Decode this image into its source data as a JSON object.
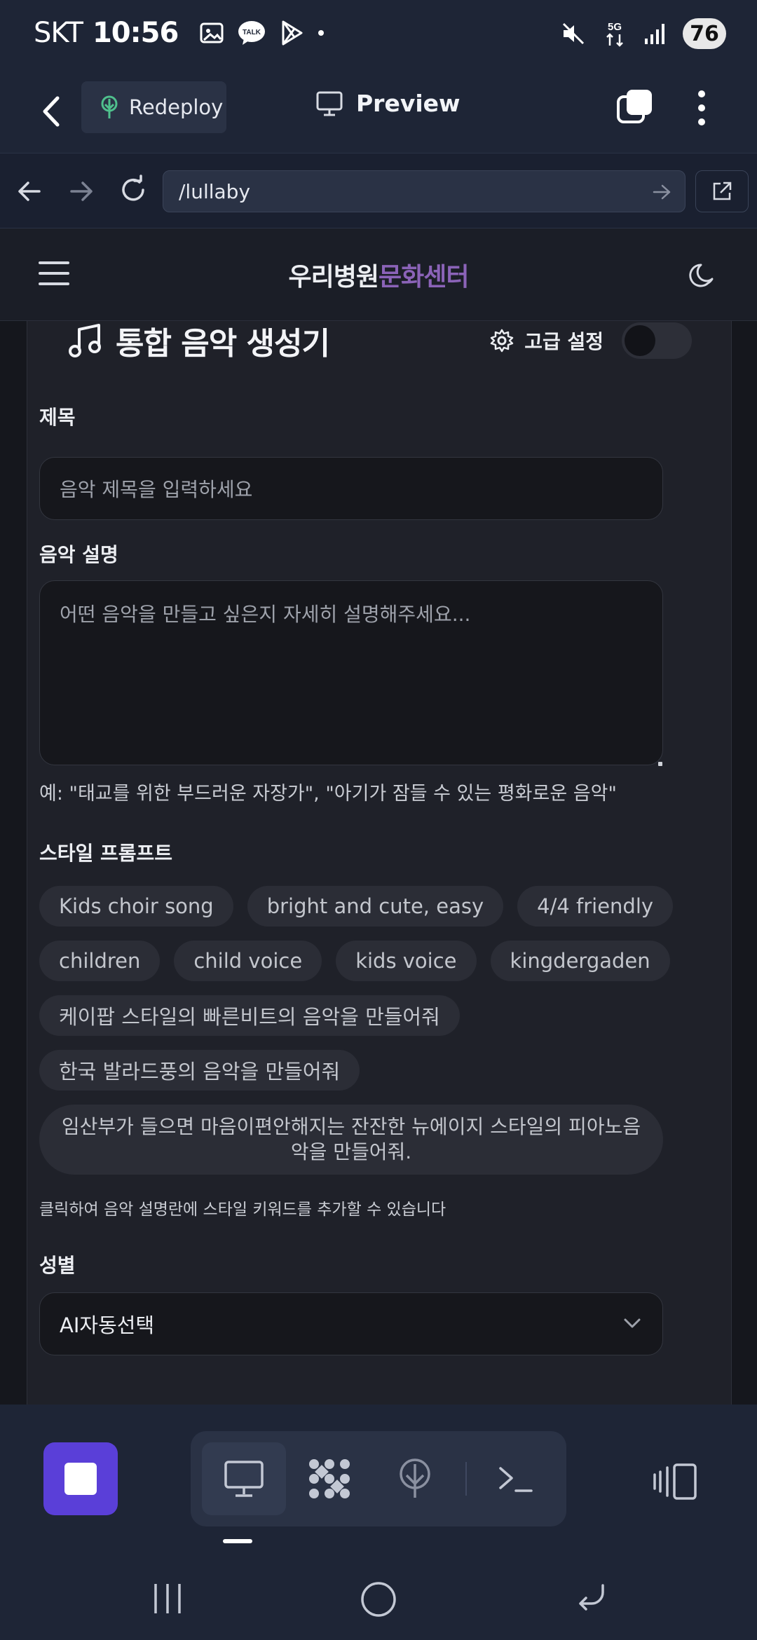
{
  "status_bar": {
    "carrier": "SKT",
    "time": "10:56",
    "battery": "76",
    "network": "5G"
  },
  "app_bar": {
    "redeploy_label": "Redeploy",
    "preview_label": "Preview"
  },
  "browser": {
    "url": "/lullaby"
  },
  "site": {
    "brand_main": "우리병원",
    "brand_accent": "문화센터",
    "accent_color": "#8b63b8"
  },
  "generator": {
    "title": "통합 음악 생성기",
    "advanced_label": "고급 설정",
    "advanced_enabled": false,
    "title_field": {
      "label": "제목",
      "placeholder": "음악 제목을 입력하세요",
      "value": ""
    },
    "description_field": {
      "label": "음악 설명",
      "placeholder": "어떤 음악을 만들고 싶은지 자세히 설명해주세요...",
      "value": ""
    },
    "description_hint": "예: \"태교를 위한 부드러운 자장가\", \"아기가 잠들 수 있는 평화로운 음악\"",
    "style_prompt": {
      "label": "스타일 프롬프트",
      "chips": [
        "Kids choir song",
        "bright and cute, easy",
        "4/4 friendly",
        "children",
        "child voice",
        "kids voice",
        "kingdergaden",
        "케이팝 스타일의 빠른비트의 음악을 만들어줘",
        "한국 발라드풍의 음악을 만들어줘",
        "임산부가 들으면 마음이편안해지는 잔잔한 뉴에이지 스타일의 피아노음악을 만들어줘."
      ],
      "note": "클릭하여 음악 설명란에 스타일 키워드를 추가할 수 있습니다"
    },
    "gender": {
      "label": "성별",
      "selected": "AI자동선택"
    }
  },
  "toolbar": {
    "stop_color": "#5a3fd8",
    "tools": [
      "monitor-icon",
      "apps-icon",
      "deploy-icon",
      "terminal-icon"
    ],
    "active_tool": "monitor-icon"
  }
}
